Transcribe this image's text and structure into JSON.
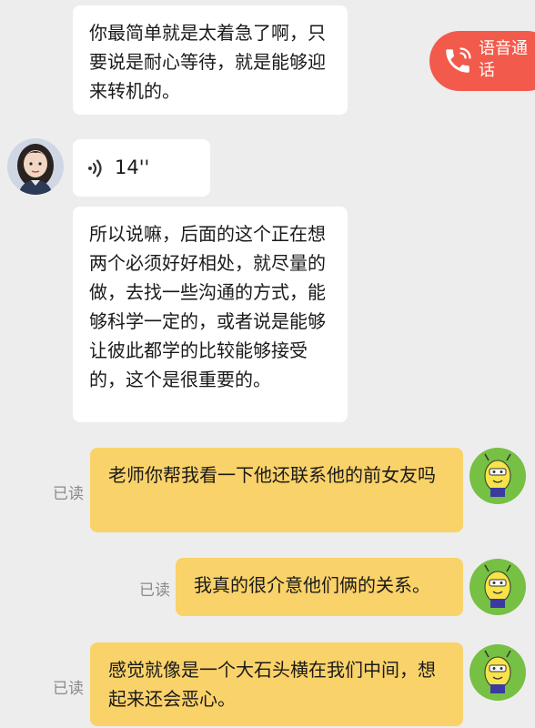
{
  "messages": [
    {
      "text": "你最简单就是太着急了啊，只要说是耐心等待，就是能够迎来转机的。"
    },
    {
      "voice_duration": "14''"
    },
    {
      "text": "所以说嘛，后面的这个正在想两个必须好好相处，就尽量的做，去找一些沟通的方式，能够科学一定的，或者说是能够让彼此都学的比较能够接受的，这个是很重要的。"
    },
    {
      "text": "老师你帮我看一下他还联系他的前女友吗",
      "status": "已读"
    },
    {
      "text": "我真的很介意他们俩的关系。",
      "status": "已读"
    },
    {
      "text": "感觉就像是一个大石头横在我们中间，想起来还会恶心。",
      "status": "已读"
    }
  ],
  "voice_call": {
    "label": "语音通话",
    "icon": "phone-icon"
  },
  "colors": {
    "background": "#ededed",
    "incoming": "#ffffff",
    "outgoing": "#fad26a",
    "call_button": "#f25a4b"
  }
}
